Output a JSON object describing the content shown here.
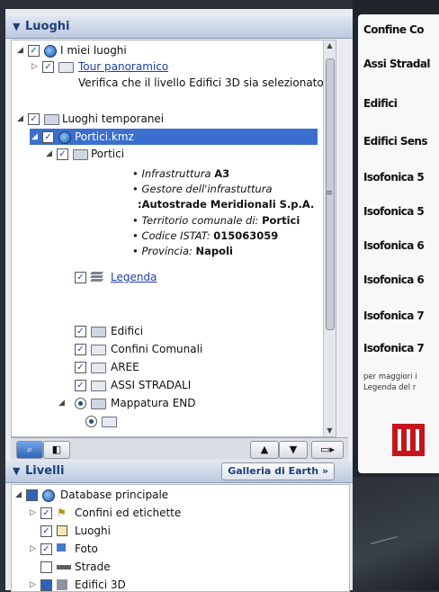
{
  "places_panel": {
    "title": "Luoghi",
    "my_places": {
      "label": "I miei luoghi",
      "tour_link": "Tour panoramico",
      "tour_description": "Verifica che il livello Edifici 3D sia selezionato"
    },
    "temp_places": {
      "label": "Luoghi temporanei",
      "kmz_label": "Portici.kmz",
      "portici_label": "Portici",
      "details": [
        {
          "key": "Infrastruttura",
          "value": "A3"
        },
        {
          "key": "Gestore dell'infrastuttura",
          "value": ""
        },
        {
          "key": "",
          "value": ":Autostrade Meridionali S.p.A."
        },
        {
          "key": "Territorio comunale di:",
          "value": "Portici"
        },
        {
          "key": "Codice ISTAT:",
          "value": "015063059"
        },
        {
          "key": "Provincia:",
          "value": "Napoli"
        }
      ],
      "legend_link": "Legenda",
      "folders": [
        "Edifici",
        "Confini Comunali",
        "AREE",
        "ASSI STRADALI",
        "Mappatura END"
      ]
    }
  },
  "places_toolbar": {
    "search_icon": "magnifier-icon",
    "panel_icon": "panel-toggle-icon",
    "up_icon": "arrow-up-icon",
    "down_icon": "arrow-down-icon",
    "folder_icon": "new-folder-icon"
  },
  "layers_panel": {
    "title": "Livelli",
    "gallery_button": "Galleria di Earth »",
    "items": [
      {
        "label": "Database principale"
      },
      {
        "label": "Confini ed etichette"
      },
      {
        "label": "Luoghi"
      },
      {
        "label": "Foto"
      },
      {
        "label": "Strade"
      },
      {
        "label": "Edifici 3D"
      }
    ]
  },
  "legend": {
    "items": [
      "Confine Co",
      "Assi Stradal",
      "Edifici",
      "Edifici Sens",
      "Isofonica 5",
      "Isofonica 5",
      "Isofonica 6",
      "Isofonica 6",
      "Isofonica 7",
      "Isofonica 7"
    ],
    "note_line1": "per maggiori i",
    "note_line2": "Legenda del r"
  },
  "colors": {
    "selection": "#3a6fd0",
    "header_text": "#1e3f7a",
    "link": "#1e3fb0",
    "logo_red": "#c4161c"
  }
}
